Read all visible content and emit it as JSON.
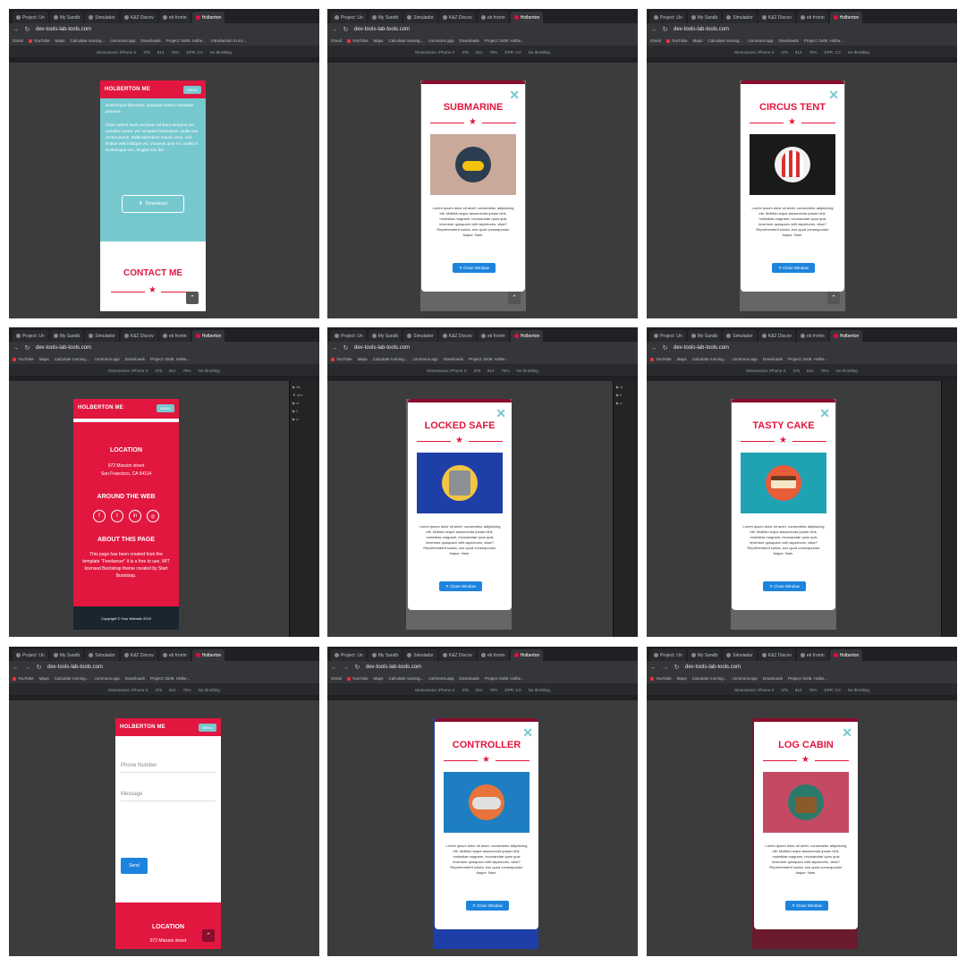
{
  "colors": {
    "brand": "#e1173f",
    "accent": "#76c8cf",
    "button": "#1c84dd",
    "modalBorder": "#8a0d2e"
  },
  "browser": {
    "url": "dev-tools-lab-tools.com",
    "tabs": [
      "Project: Un",
      "My Sandb",
      "Simulador",
      "K&Z Discov",
      "eb frontn",
      "Holberton",
      "eb front"
    ],
    "bookmarks": [
      "Gmail",
      "YouTube",
      "Maps",
      "Calculate running...",
      "commons.app",
      "Downloads",
      "Project: 0x08. Holbe...",
      "Introduction to Inc..."
    ],
    "devtools": {
      "dimensions": "Dimensions: iPhone X",
      "width": "375",
      "height": "812",
      "zoom": "75%",
      "dpr": "DPR: 3.0",
      "throttle": "No throttling"
    }
  },
  "site": {
    "brand": "HOLBERTON ME",
    "menu": "MENU",
    "close_label": "✕ Close Window",
    "lorem": "Lorem ipsum dolor sit amet, consectetur adipisicing elit. Mollitia neque assumenda ipsam nihil, molestias magnam, recusandae quos quis inventore quisquam velit asperiores, vitae? Reprehenderit soluta, eos quod consequuntur itaque. Nam."
  },
  "panels": {
    "p1": {
      "about_text": "scelerisque liberatum. Quisque viverra vulputate posuere.",
      "about_text2": "Class aptent taciti sociosqu ad litora torquent per conubia nostra, per inceptos himenaeos. Nulla non ornare purus. Nulla bibendum mauris urna, sed finibus velit tristique vel. Vivamus ante mi, mollis et scelerisque nec, feugiat non dui.",
      "download": "Download",
      "contact": "CONTACT ME"
    },
    "p2": {
      "title": "SUBMARINE"
    },
    "p3": {
      "title": "CIRCUS TENT"
    },
    "p4": {
      "location": "LOCATION",
      "address1": "972 Mission street",
      "address2": "San Francisco, CA 94114",
      "web": "AROUND THE WEB",
      "about": "ABOUT THIS PAGE",
      "about_text": "This page has been created from the template \"Freelancer\" it is a free to use, MIT licensed Bootstrap theme created by Start Bootstrap.",
      "copyright": "Copyright © Your Website 2019"
    },
    "p5": {
      "title": "LOCKED SAFE"
    },
    "p6": {
      "title": "TASTY CAKE"
    },
    "p7": {
      "phone": "Phone Number",
      "message": "Message",
      "send": "Send",
      "location": "LOCATION",
      "address1": "972 Mission street"
    },
    "p8": {
      "title": "CONTROLLER"
    },
    "p9": {
      "title": "LOG CABIN"
    }
  }
}
